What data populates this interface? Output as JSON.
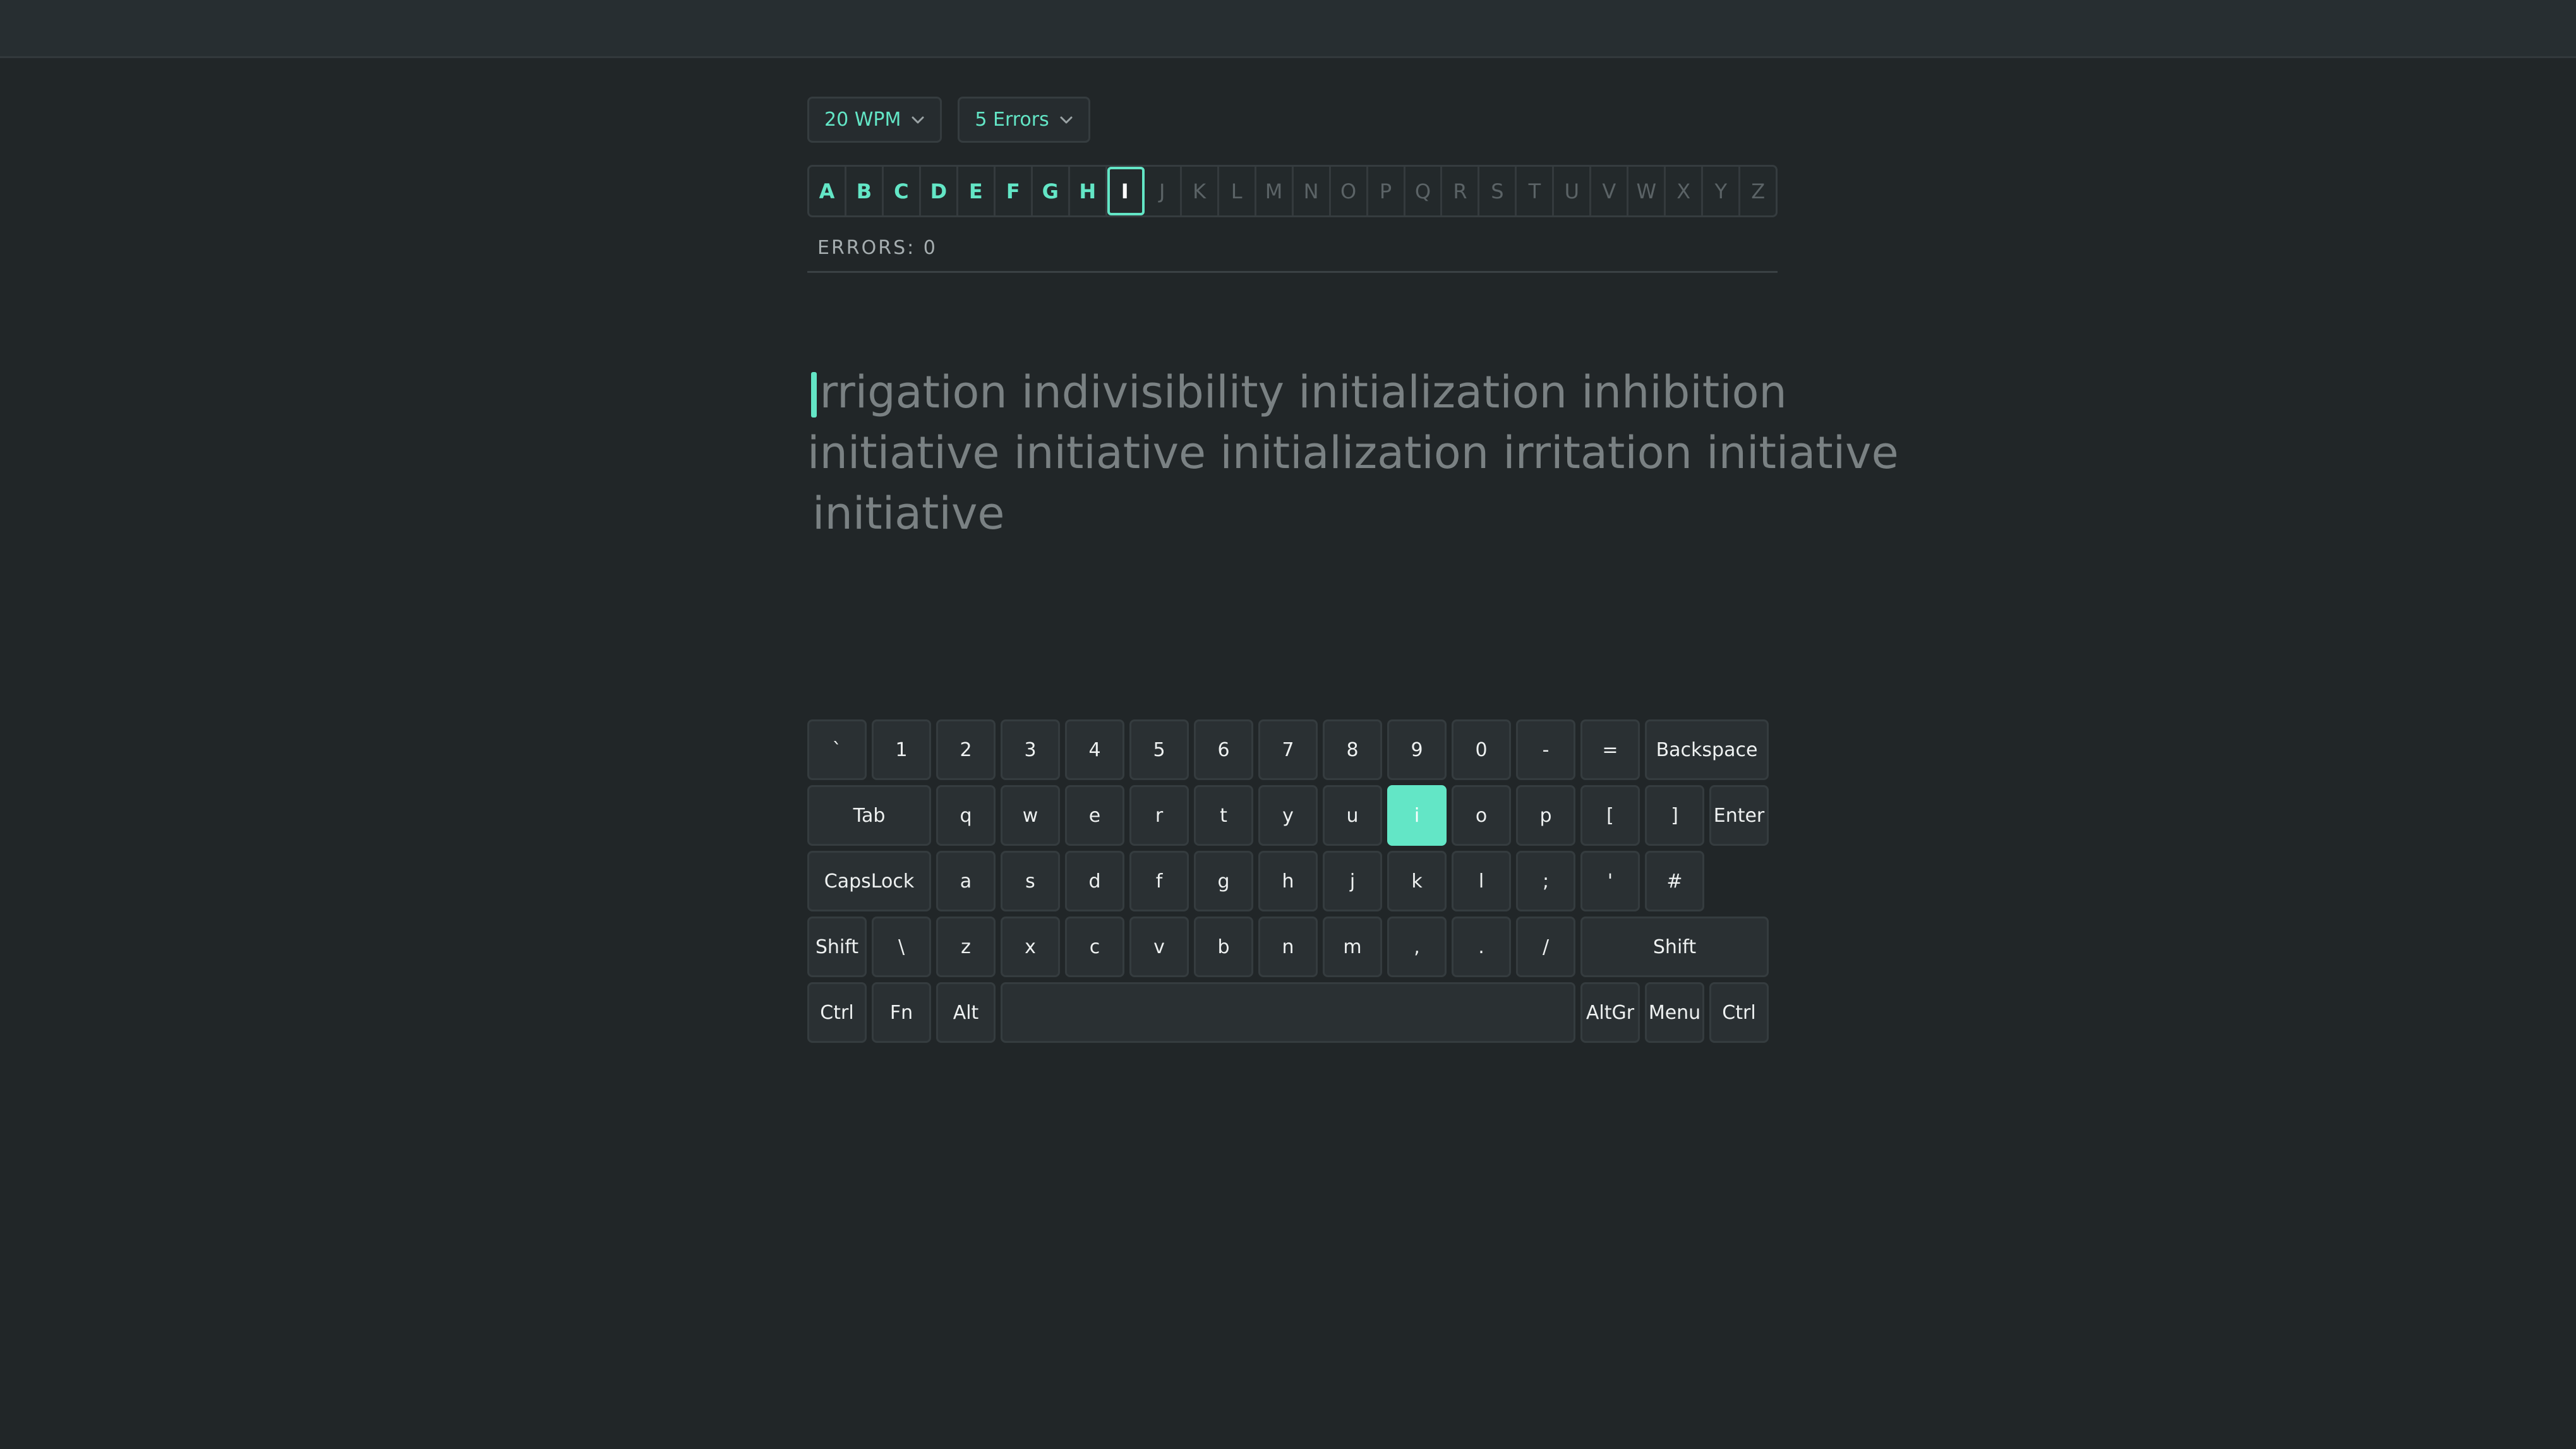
{
  "colors": {
    "accent": "#63e6c6",
    "background": "#212628",
    "topbar": "#272e31",
    "muted_text": "#7a8183"
  },
  "controls": {
    "wpm_label": "20 WPM",
    "errors_label": "5 Errors"
  },
  "letters": [
    {
      "char": "A",
      "state": "done"
    },
    {
      "char": "B",
      "state": "done"
    },
    {
      "char": "C",
      "state": "done"
    },
    {
      "char": "D",
      "state": "done"
    },
    {
      "char": "E",
      "state": "done"
    },
    {
      "char": "F",
      "state": "done"
    },
    {
      "char": "G",
      "state": "done"
    },
    {
      "char": "H",
      "state": "done"
    },
    {
      "char": "I",
      "state": "current"
    },
    {
      "char": "J",
      "state": "todo"
    },
    {
      "char": "K",
      "state": "todo"
    },
    {
      "char": "L",
      "state": "todo"
    },
    {
      "char": "M",
      "state": "todo"
    },
    {
      "char": "N",
      "state": "todo"
    },
    {
      "char": "O",
      "state": "todo"
    },
    {
      "char": "P",
      "state": "todo"
    },
    {
      "char": "Q",
      "state": "todo"
    },
    {
      "char": "R",
      "state": "todo"
    },
    {
      "char": "S",
      "state": "todo"
    },
    {
      "char": "T",
      "state": "todo"
    },
    {
      "char": "U",
      "state": "todo"
    },
    {
      "char": "V",
      "state": "todo"
    },
    {
      "char": "W",
      "state": "todo"
    },
    {
      "char": "X",
      "state": "todo"
    },
    {
      "char": "Y",
      "state": "todo"
    },
    {
      "char": "Z",
      "state": "todo"
    }
  ],
  "status": {
    "errors_text": "ERRORS: 0"
  },
  "practice": {
    "lines": [
      "irrigation indivisibility initialization inhibition",
      "initiative initiative initialization irritation initiative",
      "initiative"
    ]
  },
  "keyboard": {
    "active_key": "i",
    "rows": [
      [
        {
          "l": "`"
        },
        {
          "l": "1"
        },
        {
          "l": "2"
        },
        {
          "l": "3"
        },
        {
          "l": "4"
        },
        {
          "l": "5"
        },
        {
          "l": "6"
        },
        {
          "l": "7"
        },
        {
          "l": "8"
        },
        {
          "l": "9"
        },
        {
          "l": "0"
        },
        {
          "l": "-"
        },
        {
          "l": "="
        },
        {
          "l": "Backspace",
          "w": 2
        }
      ],
      [
        {
          "l": "Tab",
          "w": 2
        },
        {
          "l": "q"
        },
        {
          "l": "w"
        },
        {
          "l": "e"
        },
        {
          "l": "r"
        },
        {
          "l": "t"
        },
        {
          "l": "y"
        },
        {
          "l": "u"
        },
        {
          "l": "i"
        },
        {
          "l": "o"
        },
        {
          "l": "p"
        },
        {
          "l": "["
        },
        {
          "l": "]"
        },
        {
          "l": "Enter"
        }
      ],
      [
        {
          "l": "CapsLock",
          "w": 2
        },
        {
          "l": "a"
        },
        {
          "l": "s"
        },
        {
          "l": "d"
        },
        {
          "l": "f"
        },
        {
          "l": "g"
        },
        {
          "l": "h"
        },
        {
          "l": "j"
        },
        {
          "l": "k"
        },
        {
          "l": "l"
        },
        {
          "l": ";"
        },
        {
          "l": "'"
        },
        {
          "l": "#"
        }
      ],
      [
        {
          "l": "Shift"
        },
        {
          "l": "\\"
        },
        {
          "l": "z"
        },
        {
          "l": "x"
        },
        {
          "l": "c"
        },
        {
          "l": "v"
        },
        {
          "l": "b"
        },
        {
          "l": "n"
        },
        {
          "l": "m"
        },
        {
          "l": ","
        },
        {
          "l": "."
        },
        {
          "l": "/"
        },
        {
          "l": "Shift",
          "w": 3
        }
      ],
      [
        {
          "l": "Ctrl"
        },
        {
          "l": "Fn"
        },
        {
          "l": "Alt"
        },
        {
          "l": "",
          "w": 9,
          "name": "space"
        },
        {
          "l": "AltGr"
        },
        {
          "l": "Menu"
        },
        {
          "l": "Ctrl"
        }
      ]
    ]
  }
}
